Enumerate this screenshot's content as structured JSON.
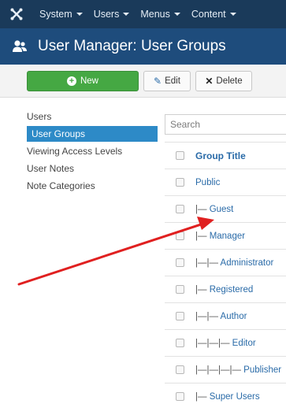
{
  "topnav": {
    "logo_icon": "joomla-logo-icon",
    "items": [
      {
        "label": "System"
      },
      {
        "label": "Users"
      },
      {
        "label": "Menus"
      },
      {
        "label": "Content"
      }
    ]
  },
  "titlebar": {
    "icon": "users-icon",
    "title": "User Manager: User Groups"
  },
  "toolbar": {
    "new_label": "New",
    "edit_label": "Edit",
    "delete_label": "Delete"
  },
  "sidebar": {
    "items": [
      {
        "label": "Users",
        "active": false
      },
      {
        "label": "User Groups",
        "active": true
      },
      {
        "label": "Viewing Access Levels",
        "active": false
      },
      {
        "label": "User Notes",
        "active": false
      },
      {
        "label": "Note Categories",
        "active": false
      }
    ]
  },
  "search": {
    "placeholder": "Search"
  },
  "table": {
    "header": "Group Title",
    "rows": [
      {
        "prefix": "",
        "title": "Public"
      },
      {
        "prefix": "|— ",
        "title": "Guest"
      },
      {
        "prefix": "|— ",
        "title": "Manager"
      },
      {
        "prefix": "|—|— ",
        "title": "Administrator"
      },
      {
        "prefix": "|— ",
        "title": "Registered"
      },
      {
        "prefix": "|—|— ",
        "title": "Author"
      },
      {
        "prefix": "|—|—|— ",
        "title": "Editor"
      },
      {
        "prefix": "|—|—|—|— ",
        "title": "Publisher"
      },
      {
        "prefix": "|— ",
        "title": "Super Users"
      }
    ]
  },
  "colors": {
    "topnav_bg": "#1a3a5a",
    "titlebar_bg": "#1e4c7c",
    "new_button": "#45a843",
    "active_sidebar": "#2d8ac7",
    "link": "#2a6ba8",
    "annotation_arrow": "#e02020"
  }
}
